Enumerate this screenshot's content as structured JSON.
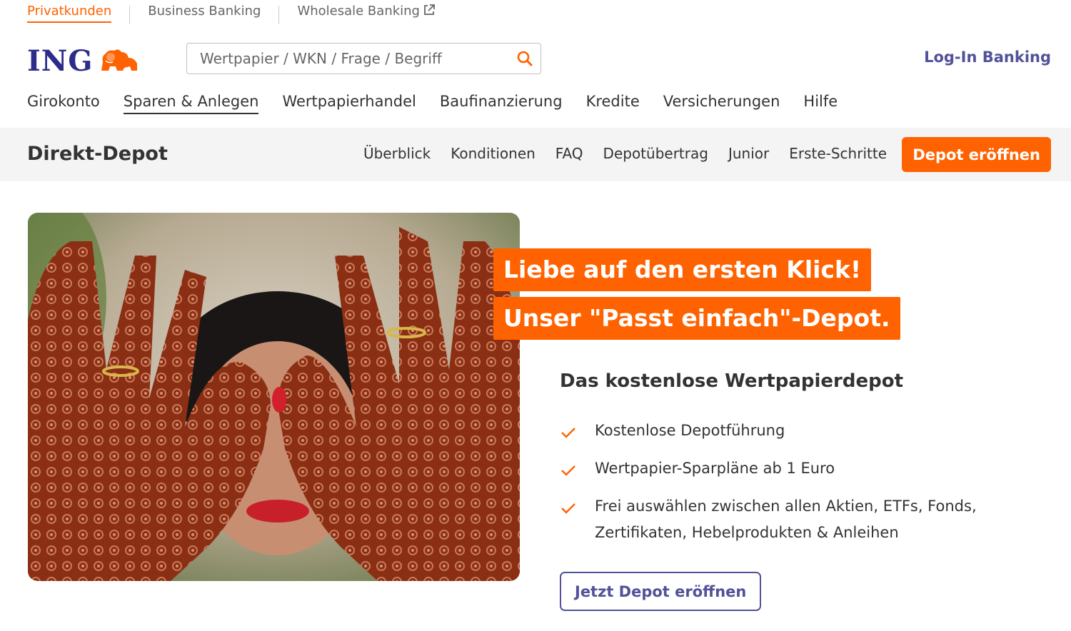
{
  "segments": [
    {
      "label": "Privatkunden",
      "active": true
    },
    {
      "label": "Business Banking",
      "active": false
    },
    {
      "label": "Wholesale Banking",
      "active": false,
      "external": true
    }
  ],
  "header": {
    "logo_text": "ING",
    "search_placeholder": "Wertpapier / WKN / Frage / Begriff",
    "login_label": "Log-In Banking"
  },
  "main_nav": [
    {
      "label": "Girokonto"
    },
    {
      "label": "Sparen & Anlegen",
      "active": true
    },
    {
      "label": "Wertpapierhandel"
    },
    {
      "label": "Baufinanzierung"
    },
    {
      "label": "Kredite"
    },
    {
      "label": "Versicherungen"
    },
    {
      "label": "Hilfe"
    }
  ],
  "subbar": {
    "title": "Direkt-Depot",
    "items": [
      {
        "label": "Überblick"
      },
      {
        "label": "Konditionen"
      },
      {
        "label": "FAQ"
      },
      {
        "label": "Depotübertrag"
      },
      {
        "label": "Junior"
      },
      {
        "label": "Erste-Schritte"
      }
    ],
    "cta_label": "Depot eröffnen"
  },
  "hero": {
    "headline_1": "Liebe auf den ersten Klick!",
    "headline_2": "Unser \"Passt einfach\"-Depot.",
    "subheading": "Das kostenlose Wertpapierdepot",
    "features": [
      "Kostenlose Depotführung",
      "Wertpapier-Sparpläne ab 1 Euro",
      "Frei auswählen zwischen allen Aktien, ETFs, Fonds, Zertifikaten, Hebelprodukten & Anleihen"
    ],
    "cta_label": "Jetzt Depot eröffnen"
  },
  "colors": {
    "brand_orange": "#ff6200",
    "brand_indigo": "#525199",
    "logo_blue": "#2c2c8a",
    "subbar_bg": "#f4f4f4"
  },
  "icons": {
    "search": "search-icon",
    "external": "external-link-icon",
    "check": "check-icon",
    "lion": "lion-logo-icon"
  }
}
